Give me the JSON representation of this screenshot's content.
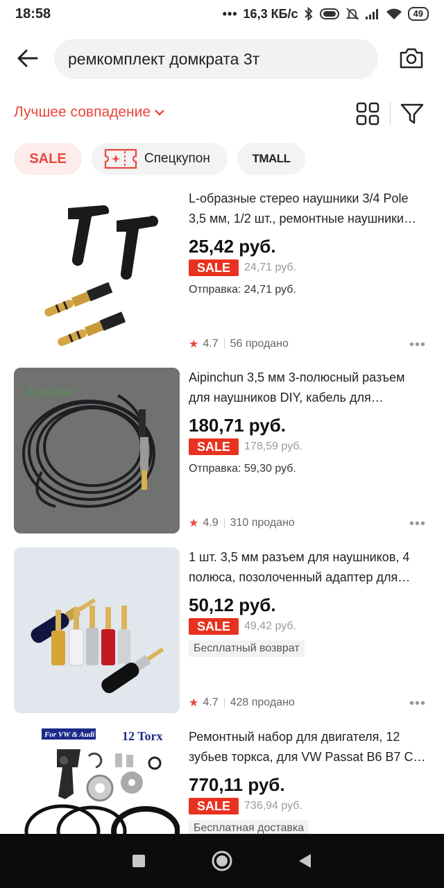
{
  "status_bar": {
    "time": "18:58",
    "dots": "•••",
    "speed": "16,3 КБ/с",
    "battery": "49"
  },
  "search": {
    "query": "ремкомплект домкрата 3т"
  },
  "sort": {
    "label": "Лучшее совпадение"
  },
  "chips": {
    "sale": "SALE",
    "coupon": "Спецкупон",
    "tmall": "TMALL"
  },
  "products": [
    {
      "title": "L-образные стерео наушники 3/4 Pole 3,5 мм, 1/2 шт., ремонтные наушники…",
      "price": "25,42 руб.",
      "sale": "SALE",
      "old_price": "24,71 руб.",
      "shipping": "Отправка: 24,71 руб.",
      "rating": "4.7",
      "sold": "56 продано"
    },
    {
      "title": "Aipinchun 3,5 мм 3-полюсный разъем для наушников DIY, кабель для…",
      "price": "180,71 руб.",
      "sale": "SALE",
      "old_price": "178,59 руб.",
      "shipping": "Отправка: 59,30 руб.",
      "rating": "4.9",
      "sold": "310 продано"
    },
    {
      "title": "1 шт. 3,5 мм разъем для наушников, 4 полюса, позолоченный адаптер для…",
      "price": "50,12 руб.",
      "sale": "SALE",
      "old_price": "49,42 руб.",
      "shipping": "Бесплатный возврат",
      "rating": "4.7",
      "sold": "428 продано"
    },
    {
      "title": "Ремонтный набор для двигателя, 12 зубьев торкса, для VW Passat B6 B7 C…",
      "price": "770,11 руб.",
      "sale": "SALE",
      "old_price": "736,94 руб.",
      "shipping": "Бесплатная доставка",
      "img_label_left": "For VW & Audi",
      "img_label_right": "12 Torx"
    }
  ],
  "colors": {
    "accent": "#e8473b",
    "sale_tag": "#e8321f",
    "nav_bar": "#0c0c0c"
  }
}
